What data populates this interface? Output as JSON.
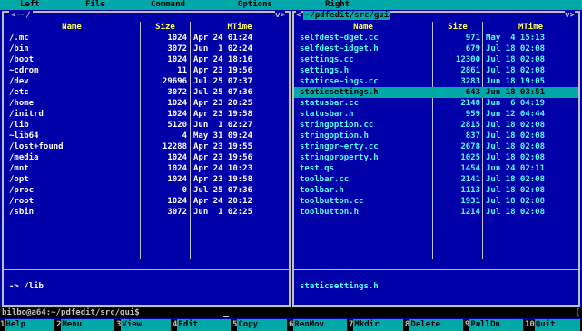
{
  "menu": [
    "Left",
    "File",
    "Command",
    "Options",
    "Right"
  ],
  "left_panel": {
    "path": "<-~/",
    "corner": "v>",
    "columns": [
      "Name",
      "Size",
      "MTime"
    ],
    "rows": [
      {
        "name": "/.mc",
        "size": "1024",
        "mtime": "Apr 24 01:24"
      },
      {
        "name": "/bin",
        "size": "3072",
        "mtime": "Jun  1 02:24"
      },
      {
        "name": "/boot",
        "size": "1024",
        "mtime": "Apr 24 18:16"
      },
      {
        "name": "~cdrom",
        "size": "11",
        "mtime": "Apr 23 19:56"
      },
      {
        "name": "/dev",
        "size": "29696",
        "mtime": "Jul 25 07:37"
      },
      {
        "name": "/etc",
        "size": "3072",
        "mtime": "Jul 25 07:36"
      },
      {
        "name": "/home",
        "size": "1024",
        "mtime": "Apr 23 20:25"
      },
      {
        "name": "/initrd",
        "size": "1024",
        "mtime": "Apr 23 19:58"
      },
      {
        "name": "/lib",
        "size": "5120",
        "mtime": "Jun  1 02:27"
      },
      {
        "name": "~lib64",
        "size": "4",
        "mtime": "May 31 09:24"
      },
      {
        "name": "/lost+found",
        "size": "12288",
        "mtime": "Apr 23 19:55"
      },
      {
        "name": "/media",
        "size": "1024",
        "mtime": "Apr 23 19:56"
      },
      {
        "name": "/mnt",
        "size": "1024",
        "mtime": "Apr 24 10:23"
      },
      {
        "name": "/opt",
        "size": "1024",
        "mtime": "Apr 23 19:58"
      },
      {
        "name": "/proc",
        "size": "0",
        "mtime": "Jul 25 07:36"
      },
      {
        "name": "/root",
        "size": "1024",
        "mtime": "Apr 24 20:12"
      },
      {
        "name": "/sbin",
        "size": "3072",
        "mtime": "Jun  1 02:25"
      }
    ],
    "info": "-> /lib"
  },
  "right_panel": {
    "path": "~/pdfedit/src/gui",
    "corner_left": "<",
    "corner": "v>",
    "columns": [
      "Name",
      "Size",
      "MTime"
    ],
    "rows": [
      {
        "name": "selfdest~dget.cc",
        "size": "971",
        "mtime": "May  4 15:13"
      },
      {
        "name": "selfdest~idget.h",
        "size": "679",
        "mtime": "Jul 18 02:08"
      },
      {
        "name": "settings.cc",
        "size": "12300",
        "mtime": "Jul 18 02:08"
      },
      {
        "name": "settings.h",
        "size": "2861",
        "mtime": "Jul 18 02:08"
      },
      {
        "name": "staticse~ings.cc",
        "size": "3283",
        "mtime": "Jun 18 19:05"
      },
      {
        "name": "staticsettings.h",
        "size": "643",
        "mtime": "Jun 18 03:51"
      },
      {
        "name": "statusbar.cc",
        "size": "2148",
        "mtime": "Jun  6 04:19"
      },
      {
        "name": "statusbar.h",
        "size": "959",
        "mtime": "Jun 12 04:44"
      },
      {
        "name": "stringoption.cc",
        "size": "2815",
        "mtime": "Jul 18 02:08"
      },
      {
        "name": "stringoption.h",
        "size": "837",
        "mtime": "Jul 18 02:08"
      },
      {
        "name": "stringpr~erty.cc",
        "size": "2678",
        "mtime": "Jul 18 02:08"
      },
      {
        "name": "stringproperty.h",
        "size": "1025",
        "mtime": "Jul 18 02:08"
      },
      {
        "name": "test.qs",
        "size": "1454",
        "mtime": "Jun 24 02:11"
      },
      {
        "name": "toolbar.cc",
        "size": "2141",
        "mtime": "Jul 18 02:08"
      },
      {
        "name": "toolbar.h",
        "size": "1113",
        "mtime": "Jul 18 02:08"
      },
      {
        "name": "toolbutton.cc",
        "size": "1931",
        "mtime": "Jul 18 02:08"
      },
      {
        "name": "toolbutton.h",
        "size": "1214",
        "mtime": "Jul 18 02:08"
      }
    ],
    "selected_index": 5,
    "info": "staticsettings.h"
  },
  "command_line": {
    "prompt": "bilbo@a64:~/pdfedit/src/gui$",
    "bracket": "["
  },
  "fkeys": [
    {
      "num": "1",
      "label": "Help"
    },
    {
      "num": "2",
      "label": "Menu"
    },
    {
      "num": "3",
      "label": "View"
    },
    {
      "num": "4",
      "label": "Edit"
    },
    {
      "num": "5",
      "label": "Copy"
    },
    {
      "num": "6",
      "label": "RenMov"
    },
    {
      "num": "7",
      "label": "Mkdir"
    },
    {
      "num": "8",
      "label": "Delete"
    },
    {
      "num": "9",
      "label": "PullDn"
    },
    {
      "num": "10",
      "label": "Quit"
    }
  ],
  "colors": {
    "panel_bg": "#0000a8",
    "highlight": "#00a8a8",
    "header": "#ffff54",
    "file_text": "#54ffff"
  }
}
